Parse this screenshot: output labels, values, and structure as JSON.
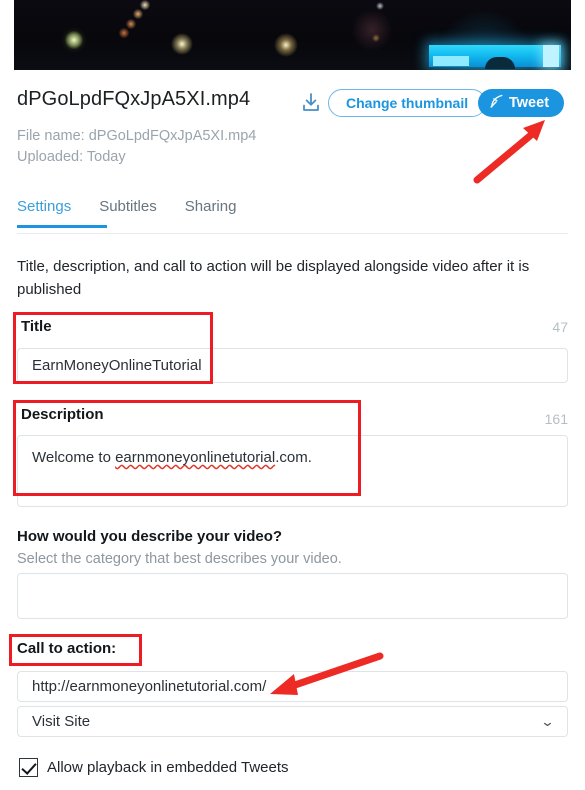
{
  "thumbnail": {
    "alt": "video-thumbnail-night-scene"
  },
  "header": {
    "file_title": "dPGoLpdFQxJpA5XI.mp4",
    "file_name_line": "File name: dPGoLpdFQxJpA5XI.mp4",
    "uploaded_line": "Uploaded: Today",
    "download_icon": "download-icon",
    "change_thumbnail_label": "Change thumbnail",
    "tweet_label": "Tweet",
    "tweet_icon": "feather-quill-icon",
    "accent_color": "#1b95e0"
  },
  "tabs": [
    {
      "label": "Settings",
      "active": true
    },
    {
      "label": "Subtitles",
      "active": false
    },
    {
      "label": "Sharing",
      "active": false
    }
  ],
  "intro_text": "Title, description, and call to action will be displayed alongside video after it is published",
  "title_field": {
    "label": "Title",
    "value": "EarnMoneyOnlineTutorial",
    "counter": "47"
  },
  "description_field": {
    "label": "Description",
    "value_prefix": "Welcome to ",
    "value_misspelled": "earnmoneyonlinetutorial",
    "value_suffix": ".com.",
    "counter": "161"
  },
  "category_field": {
    "label": "How would you describe your video?",
    "hint": "Select the category that best describes your video.",
    "value": ""
  },
  "call_to_action": {
    "label": "Call to action:",
    "url_value": "http://earnmoneyonlinetutorial.com/",
    "select_value": "Visit Site",
    "chevron_icon": "chevron-down-icon"
  },
  "embed_checkbox": {
    "label": "Allow playback in embedded Tweets",
    "checked": true
  },
  "annotations": {
    "highlight_color": "#ed1c24",
    "boxes": [
      "title-section",
      "description-section",
      "call-to-action-label"
    ],
    "arrows": [
      "arrow-to-tweet-button",
      "arrow-to-url-field"
    ]
  }
}
